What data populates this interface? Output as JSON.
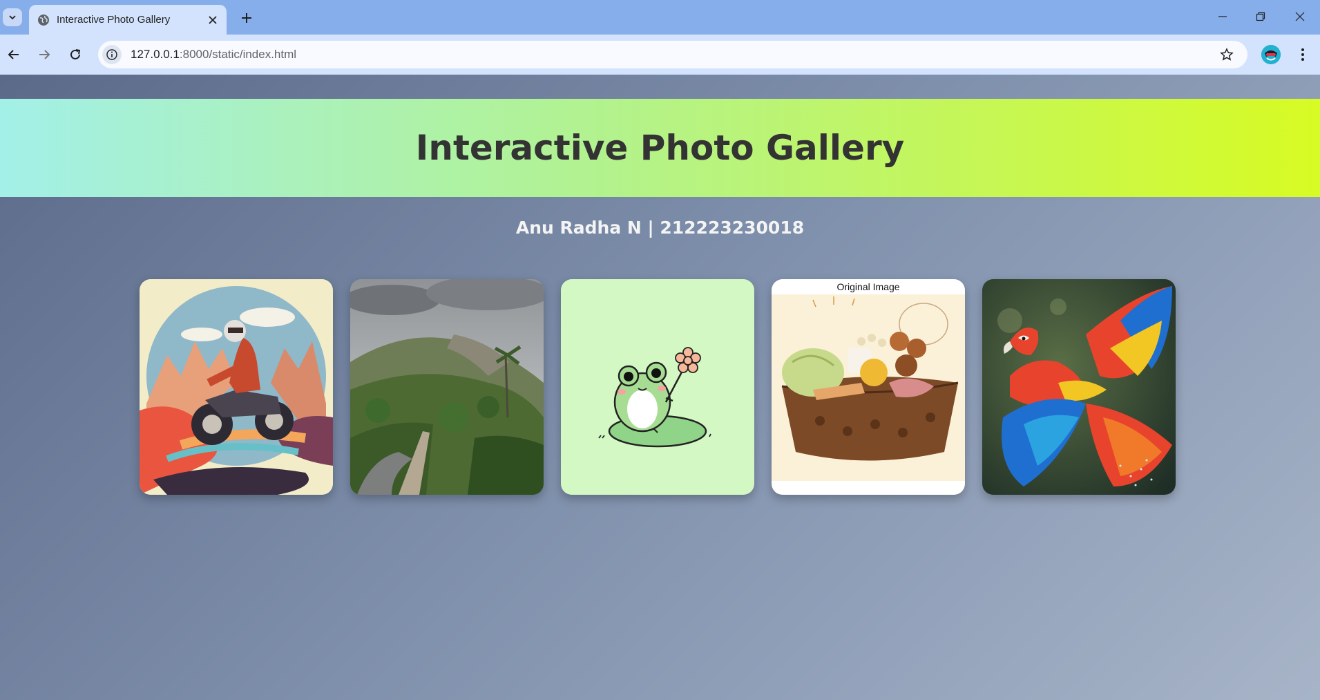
{
  "browser": {
    "tab_title": "Interactive Photo Gallery",
    "url_host": "127.0.0.1",
    "url_path": ":8000/static/index.html"
  },
  "page": {
    "heading": "Interactive Photo Gallery",
    "subtitle": "Anu Radha N | 212223230018"
  },
  "gallery": {
    "items": [
      {
        "subject": "motorcycle-rider-illustration"
      },
      {
        "subject": "hillside-road-photo"
      },
      {
        "subject": "frog-with-flower-illustration"
      },
      {
        "subject": "food-bowl-illustration",
        "caption": "Original Image"
      },
      {
        "subject": "macaw-parrot-photo"
      }
    ]
  },
  "colors": {
    "hero_gradient_start": "#a3f0e8",
    "hero_gradient_end": "#d7fb23",
    "heading_text": "#333333",
    "page_background": "#6f7f9c"
  }
}
